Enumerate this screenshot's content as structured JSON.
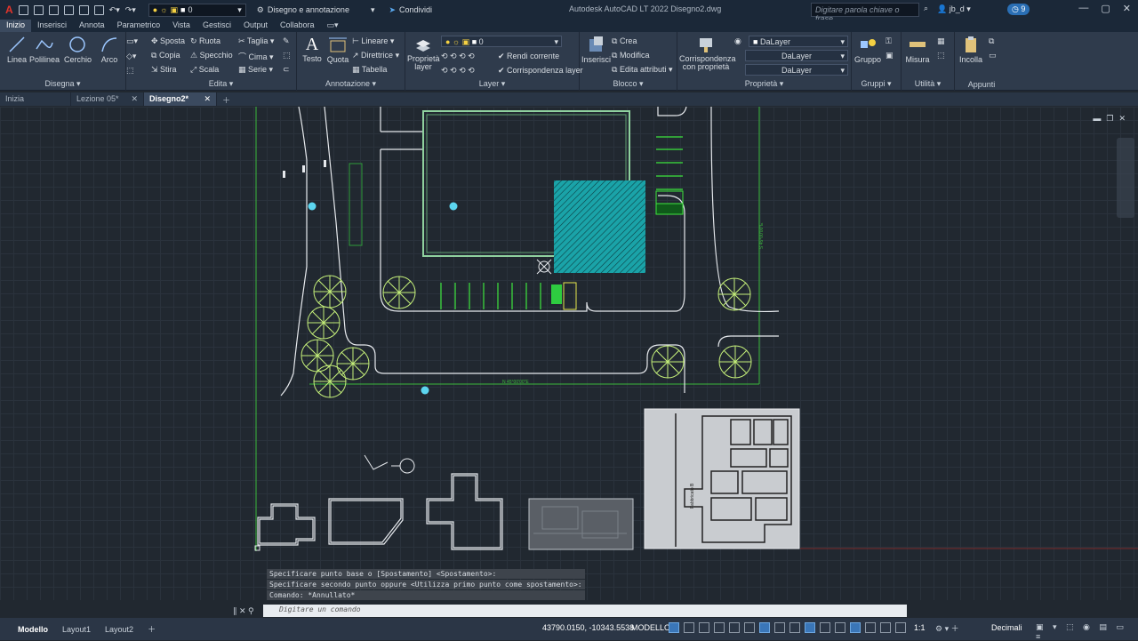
{
  "titlebar": {
    "app_letter": "A",
    "layer_current": "0",
    "workspace": "Disegno e annotazione",
    "share_label": "Condividi",
    "title": "Autodesk AutoCAD LT 2022    Disegno2.dwg",
    "search_placeholder": "Digitare parola chiave o frase",
    "user": "jb_d",
    "clock_count": "9"
  },
  "ribbon_tabs": [
    "Inizio",
    "Inserisci",
    "Annota",
    "Parametrico",
    "Vista",
    "Gestisci",
    "Output",
    "Collabora"
  ],
  "ribbon": {
    "disegna": {
      "title": "Disegna",
      "linea": "Linea",
      "polilinea": "Polilinea",
      "cerchio": "Cerchio",
      "arco": "Arco"
    },
    "edita": {
      "title": "Edita",
      "sposta": "Sposta",
      "ruota": "Ruota",
      "taglia": "Taglia",
      "copia": "Copia",
      "specchio": "Specchio",
      "cima": "Cima",
      "stira": "Stira",
      "scala": "Scala",
      "serie": "Serie"
    },
    "annotazione": {
      "title": "Annotazione",
      "testo": "Testo",
      "quota": "Quota",
      "lineare": "Lineare",
      "direttrice": "Direttrice",
      "tabella": "Tabella"
    },
    "layer": {
      "title": "Layer",
      "proprieta": "Proprietà layer",
      "combo": "0",
      "rendi_corrente": "Rendi corrente",
      "corrispondenza": "Corrispondenza layer"
    },
    "blocco": {
      "title": "Blocco",
      "inserisci": "Inserisci",
      "crea": "Crea",
      "modifica": "Modifica",
      "edita_attributi": "Edita attributi"
    },
    "proprieta": {
      "title": "Proprietà",
      "corrispondenza": "Corrispondenza con proprietà",
      "c1": "DaLayer",
      "c2": "DaLayer",
      "c3": "DaLayer"
    },
    "gruppi": {
      "title": "Gruppi",
      "gruppo": "Gruppo"
    },
    "utilita": {
      "title": "Utilità",
      "misura": "Misura"
    },
    "appunti": {
      "title": "Appunti",
      "incolla": "Incolla"
    }
  },
  "doc_tabs": [
    "Inizia",
    "Lezione 05*",
    "Disegno2*"
  ],
  "command": {
    "history": [
      "Specificare punto base o [Spostamento] <Spostamento>:",
      "Specificare secondo punto oppure <Utilizza primo punto come spostamento>:",
      "Comando: *Annullato*"
    ],
    "placeholder": "Digitare un comando"
  },
  "drawing_labels": {
    "bottom_dim": "N 45°00'00\"E",
    "right_dim": "S 45°00'00\"E",
    "plan_label": "Fabbricato B"
  },
  "status": {
    "layout_tabs": [
      "Modello",
      "Layout1",
      "Layout2"
    ],
    "coords": "43790.0150, -10343.5538",
    "mode": "MODELLO",
    "ratio": "1:1",
    "units": "Decimali"
  },
  "colors": {
    "accent": "#3a76b8",
    "green": "#2ecc40",
    "teal": "#1aa3a8",
    "cyan": "#5cd6f0"
  }
}
